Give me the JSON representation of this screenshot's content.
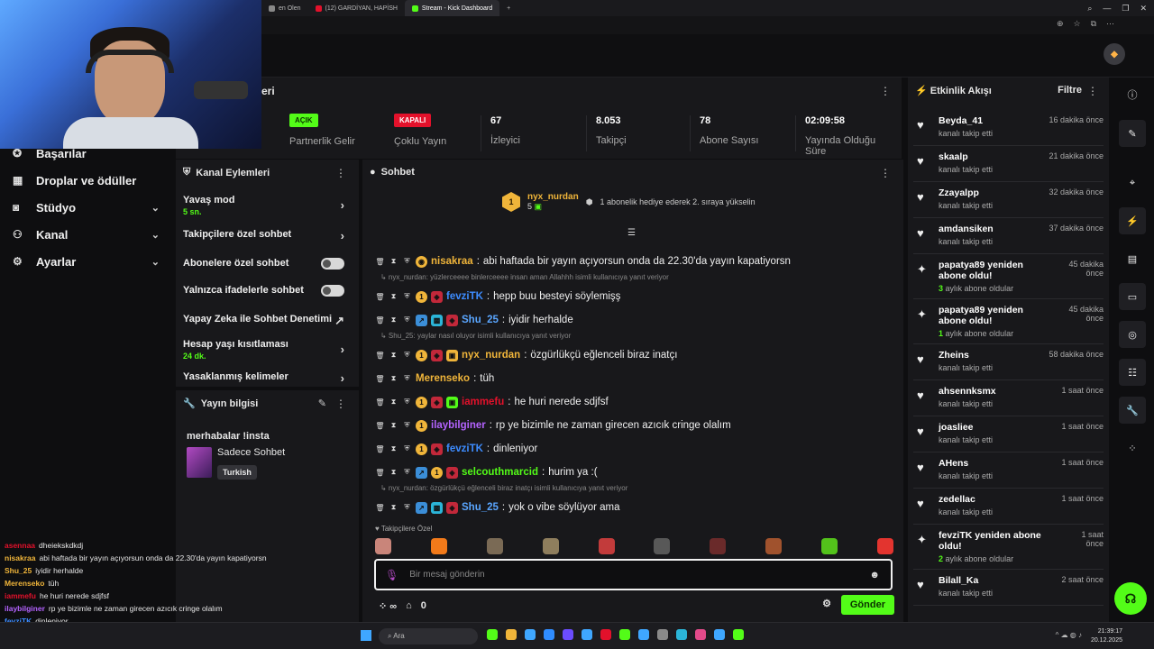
{
  "browser": {
    "tabs": [
      {
        "label": "en Olen",
        "active": false,
        "color": "#888"
      },
      {
        "label": "(12) GARDİYAN, HAPİSH",
        "active": false,
        "color": "#e3112b"
      },
      {
        "label": "Stream - Kick Dashboard",
        "active": true,
        "color": "#53fc18"
      }
    ],
    "newtab": "+",
    "controls": [
      "⌕",
      "—",
      "❐",
      "✕"
    ]
  },
  "nav": {
    "items": [
      {
        "label": "Başarılar",
        "icon": "trophy-icon",
        "glyph": "✪",
        "chevron": false
      },
      {
        "label": "Droplar ve ödüller",
        "icon": "gift-icon",
        "glyph": "▦",
        "chevron": false
      },
      {
        "label": "Stüdyo",
        "icon": "studio-icon",
        "glyph": "◙",
        "chevron": true
      },
      {
        "label": "Kanal",
        "icon": "channel-icon",
        "glyph": "⚇",
        "chevron": true
      },
      {
        "label": "Ayarlar",
        "icon": "gear-icon",
        "glyph": "⚙",
        "chevron": true
      }
    ]
  },
  "stats": {
    "header": "eri",
    "items": [
      {
        "value": "AÇIK",
        "label": "Partnerlik Gelir",
        "pill": "on"
      },
      {
        "value": "KAPALI",
        "label": "Çoklu Yayın",
        "pill": "off"
      },
      {
        "value": "67",
        "label": "İzleyici"
      },
      {
        "value": "8.053",
        "label": "Takipçi"
      },
      {
        "value": "78",
        "label": "Abone Sayısı"
      },
      {
        "value": "02:09:58",
        "label": "Yayında Olduğu Süre"
      }
    ]
  },
  "kanal_eylemleri": {
    "title": "Kanal Eylemleri",
    "rows": [
      {
        "label": "Yavaş mod",
        "sub": "5 sn.",
        "control": "arrow"
      },
      {
        "label": "Takipçilere özel sohbet",
        "sub": "",
        "control": "arrow"
      },
      {
        "label": "Abonelere özel sohbet",
        "sub": "",
        "control": "toggle"
      },
      {
        "label": "Yalnızca ifadelerle sohbet",
        "sub": "",
        "control": "toggle"
      },
      {
        "label": "Yapay Zeka ile Sohbet Denetimi",
        "sub": "",
        "control": "external"
      },
      {
        "label": "Hesap yaşı kısıtlaması",
        "sub": "24 dk.",
        "control": "arrow"
      },
      {
        "label": "Yasaklanmış kelimeler",
        "sub": "",
        "control": "arrow"
      }
    ]
  },
  "yayin_bilgisi": {
    "title": "Yayın bilgisi",
    "stream_title": "merhabalar !insta",
    "category": "Sadece Sohbet",
    "tag": "Turkish"
  },
  "chat": {
    "title": "Sohbet",
    "pinned": {
      "rank": "1",
      "user": "nyx_nurdan",
      "count": "5",
      "message": "1 abonelik hediye ederek 2. sıraya yükselin"
    },
    "messages": [
      {
        "reply": "",
        "badges": [
          {
            "c": "#f0b53a",
            "t": "coin"
          }
        ],
        "user": "nisakraa",
        "color": "#f0b53a",
        "text": "abi haftada bir yayın açıyorsun onda da 22.30'da yayın kapatiyorsn"
      },
      {
        "reply": "nyx_nurdan: yüzlerceeee binlerceeee insan aman Allahhh isimli kullanıcıya yanıt veriyor",
        "badges": [
          {
            "c": "#f0b53a",
            "t": "1"
          },
          {
            "c": "#c2283a",
            "t": "wolf"
          }
        ],
        "user": "fevziTK",
        "color": "#3d8cff",
        "text": "hepp buu besteyi söylemişş"
      },
      {
        "reply": "",
        "badges": [
          {
            "c": "#3b8ed8",
            "t": "a"
          },
          {
            "c": "#2bb5d8",
            "t": "b"
          },
          {
            "c": "#c2283a",
            "t": "wolf"
          }
        ],
        "user": "Shu_25",
        "color": "#5aa6ff",
        "text": "iyidir herhalde"
      },
      {
        "reply": "Shu_25: yaylar nasıl oluyor isimli kullanıcıya yanıt veriyor",
        "badges": [
          {
            "c": "#f0b53a",
            "t": "1"
          },
          {
            "c": "#c2283a",
            "t": "wolf"
          },
          {
            "c": "#f0b53a",
            "t": "gift"
          }
        ],
        "user": "nyx_nurdan",
        "color": "#f0b53a",
        "text": "özgürlükçü eğlenceli biraz inatçı"
      },
      {
        "reply": "",
        "badges": [],
        "user": "Merenseko",
        "color": "#f0b53a",
        "text": "tüh"
      },
      {
        "reply": "",
        "badges": [
          {
            "c": "#f0b53a",
            "t": "1"
          },
          {
            "c": "#c2283a",
            "t": "wolf"
          },
          {
            "c": "#53fc18",
            "t": "gift"
          }
        ],
        "user": "iammefu",
        "color": "#e3112b",
        "text": "he huri nerede sdjfsf"
      },
      {
        "reply": "",
        "badges": [
          {
            "c": "#f0b53a",
            "t": "1"
          }
        ],
        "user": "ilaybilginer",
        "color": "#b463ff",
        "text": "rp ye bizimle ne zaman girecen azıcık cringe olalım"
      },
      {
        "reply": "",
        "badges": [
          {
            "c": "#f0b53a",
            "t": "1"
          },
          {
            "c": "#c2283a",
            "t": "wolf"
          }
        ],
        "user": "fevziTK",
        "color": "#3d8cff",
        "text": "dinleniyor"
      },
      {
        "reply": "",
        "badges": [
          {
            "c": "#3b8ed8",
            "t": "a"
          },
          {
            "c": "#f0b53a",
            "t": "1"
          },
          {
            "c": "#c2283a",
            "t": "wolf"
          }
        ],
        "user": "selcouthmarcid",
        "color": "#53fc18",
        "text": "hurim ya :("
      },
      {
        "reply": "nyx_nurdan: özgürlükçü eğlenceli biraz inatçı isimli kullanıcıya yanıt veriyor",
        "badges": [
          {
            "c": "#3b8ed8",
            "t": "a"
          },
          {
            "c": "#2bb5d8",
            "t": "b"
          },
          {
            "c": "#c2283a",
            "t": "wolf"
          }
        ],
        "user": "Shu_25",
        "color": "#5aa6ff",
        "text": "yok o vibe söylüyor ama"
      }
    ],
    "followers_only": "Takipçilere Özel",
    "emote_colors": [
      "#c9857a",
      "#f27a1a",
      "#7a6a55",
      "#8f7e5d",
      "#c23b3b",
      "#585858",
      "#6a2a2a",
      "#a0522d",
      "#53c21b",
      "#e3342f"
    ],
    "input_placeholder": "Bir mesaj gönderin",
    "points": "0",
    "send_label": "Gönder"
  },
  "feed": {
    "title": "Etkinlik Akışı",
    "filter": "Filtre",
    "items": [
      {
        "type": "follow",
        "name": "Beyda_41",
        "desc": "kanalı takip etti",
        "time": "16 dakika önce"
      },
      {
        "type": "follow",
        "name": "skaalp",
        "desc": "kanalı takip etti",
        "time": "21 dakika önce"
      },
      {
        "type": "follow",
        "name": "Zzayalpp",
        "desc": "kanalı takip etti",
        "time": "32 dakika önce"
      },
      {
        "type": "follow",
        "name": "amdansiken",
        "desc": "kanalı takip etti",
        "time": "37 dakika önce"
      },
      {
        "type": "sub",
        "name": "papatya89 yeniden abone oldu!",
        "months": "3",
        "desc": "aylık abone oldular",
        "time": "45 dakika önce"
      },
      {
        "type": "sub",
        "name": "papatya89 yeniden abone oldu!",
        "months": "1",
        "desc": "aylık abone oldular",
        "time": "45 dakika önce"
      },
      {
        "type": "follow",
        "name": "Zheins",
        "desc": "kanalı takip etti",
        "time": "58 dakika önce"
      },
      {
        "type": "follow",
        "name": "ahsennksmx",
        "desc": "kanalı takip etti",
        "time": "1 saat önce"
      },
      {
        "type": "follow",
        "name": "joasliee",
        "desc": "kanalı takip etti",
        "time": "1 saat önce"
      },
      {
        "type": "follow",
        "name": "AHens",
        "desc": "kanalı takip etti",
        "time": "1 saat önce"
      },
      {
        "type": "follow",
        "name": "zedellac",
        "desc": "kanalı takip etti",
        "time": "1 saat önce"
      },
      {
        "type": "sub",
        "name": "fevziTK yeniden abone oldu!",
        "months": "2",
        "desc": "aylık abone oldular",
        "time": "1 saat önce"
      },
      {
        "type": "follow",
        "name": "Bilall_Ka",
        "desc": "kanalı takip etti",
        "time": "2 saat önce"
      }
    ]
  },
  "overlay": [
    {
      "user": "asennaa",
      "color": "#e3112b",
      "text": "dheiekskdkdj"
    },
    {
      "user": "nisakraa",
      "color": "#f0b53a",
      "text": "abi haftada bir yayın açıyorsun onda da 22.30'da yayın kapatiyorsn"
    },
    {
      "user": "Shu_25",
      "color": "#f0b53a",
      "text": "iyidir herhalde"
    },
    {
      "user": "Merenseko",
      "color": "#f0b53a",
      "text": "tüh"
    },
    {
      "user": "iammefu",
      "color": "#e3112b",
      "text": "he huri nerede sdjfsf"
    },
    {
      "user": "ilaybilginer",
      "color": "#b463ff",
      "text": "rp ye bizimle ne zaman girecen azıcık cringe olalım"
    },
    {
      "user": "fevziTK",
      "color": "#3d8cff",
      "text": "dinleniyor"
    },
    {
      "user": "selcouthmarcid",
      "color": "#53fc18",
      "text": "hurim ya :("
    }
  ],
  "taskbar": {
    "search": "Ara",
    "time": "21:39:17",
    "date": "20.12.2025",
    "app_colors": [
      "#53fc18",
      "#f0b53a",
      "#3fa7ff",
      "#2f8cff",
      "#6b4cff",
      "#3fa7ff",
      "#e3112b",
      "#53fc18",
      "#3fa7ff",
      "#8a8a8a",
      "#2bb5d8",
      "#e34a8a",
      "#3fa7ff",
      "#53fc18"
    ]
  }
}
